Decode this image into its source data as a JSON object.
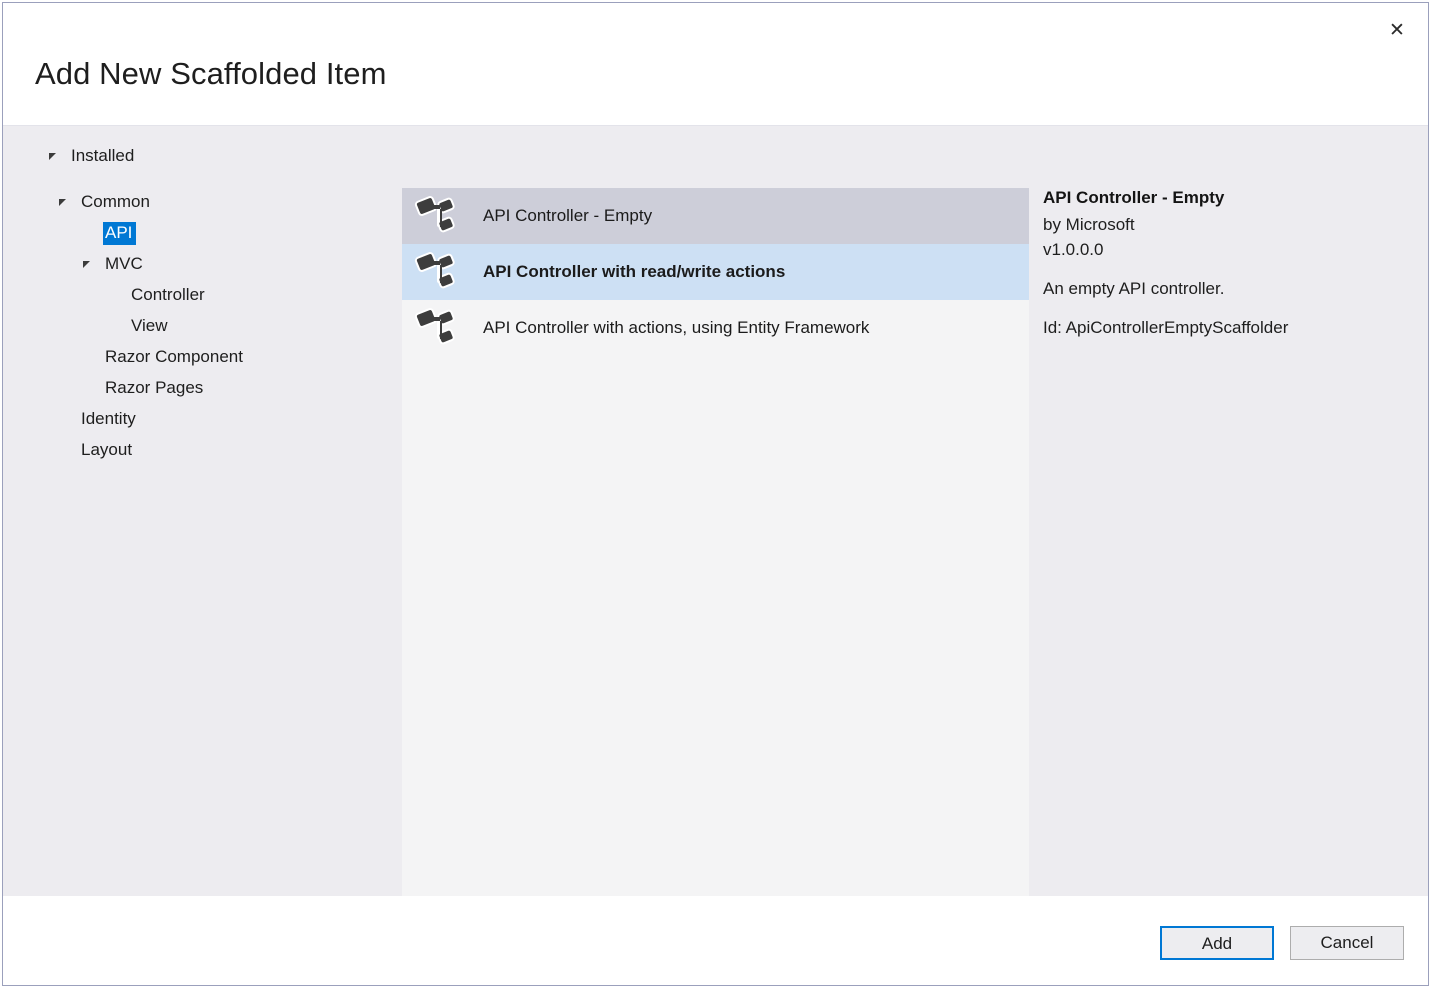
{
  "dialog": {
    "title": "Add New Scaffolded Item",
    "close_label": "✕"
  },
  "tree": {
    "items": [
      {
        "label": "Installed",
        "level": 0,
        "expander": "open",
        "selected": false
      },
      {
        "label": "Common",
        "level": 1,
        "expander": "open",
        "selected": false
      },
      {
        "label": "API",
        "level": 2,
        "expander": "none",
        "selected": true
      },
      {
        "label": "MVC",
        "level": 2,
        "expander": "open",
        "selected": false
      },
      {
        "label": "Controller",
        "level": 3,
        "expander": "none",
        "selected": false
      },
      {
        "label": "View",
        "level": 3,
        "expander": "none",
        "selected": false
      },
      {
        "label": "Razor Component",
        "level": 2,
        "expander": "none",
        "selected": false
      },
      {
        "label": "Razor Pages",
        "level": 2,
        "expander": "none",
        "selected": false
      },
      {
        "label": "Identity",
        "level": 1,
        "expander": "none",
        "selected": false
      },
      {
        "label": "Layout",
        "level": 1,
        "expander": "none",
        "selected": false
      }
    ]
  },
  "list": {
    "items": [
      {
        "label": "API Controller - Empty",
        "state": "selected",
        "icon": "scaffold-controller-icon"
      },
      {
        "label": "API Controller with read/write actions",
        "state": "focus",
        "icon": "scaffold-controller-icon"
      },
      {
        "label": "API Controller with actions, using Entity Framework",
        "state": "normal",
        "icon": "scaffold-controller-icon"
      }
    ]
  },
  "details": {
    "title": "API Controller - Empty",
    "author": "by Microsoft",
    "version": "v1.0.0.0",
    "description": "An empty API controller.",
    "id": "Id: ApiControllerEmptyScaffolder"
  },
  "footer": {
    "add_label": "Add",
    "cancel_label": "Cancel"
  },
  "colors": {
    "accent": "#0078d4",
    "dialog_border": "#9ba0bc",
    "panel_bg": "#edecf0",
    "list_bg": "#f4f4f5",
    "row_selected": "#cdced9",
    "row_focus": "#cde0f4"
  }
}
